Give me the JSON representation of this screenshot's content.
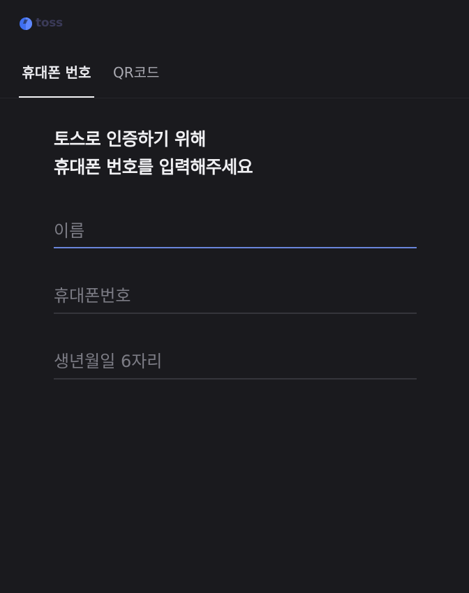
{
  "brand": {
    "name": "toss"
  },
  "tabs": [
    {
      "label": "휴대폰 번호",
      "active": true
    },
    {
      "label": "QR코드",
      "active": false
    }
  ],
  "heading": {
    "line1": "토스로 인증하기 위해",
    "line2": "휴대폰 번호를 입력해주세요"
  },
  "form": {
    "name": {
      "placeholder": "이름",
      "value": ""
    },
    "phone": {
      "placeholder": "휴대폰번호",
      "value": ""
    },
    "birth": {
      "placeholder": "생년월일 6자리",
      "value": ""
    }
  },
  "colors": {
    "background": "#1a1a1e",
    "accent_focus_line": "#6a85db",
    "logo_blue": "#3f6ff0"
  }
}
